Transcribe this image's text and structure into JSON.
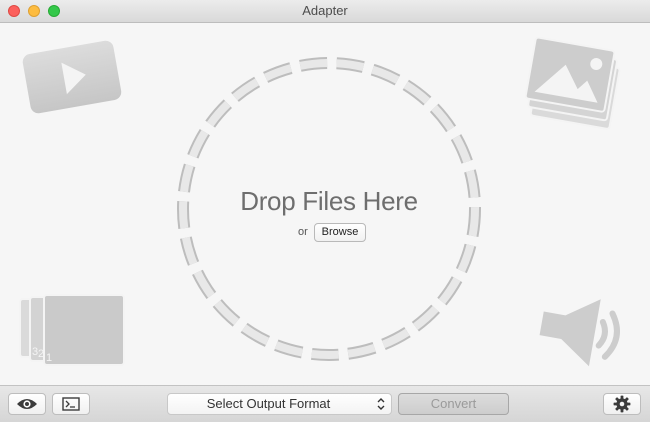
{
  "window": {
    "title": "Adapter"
  },
  "drop_zone": {
    "title": "Drop Files Here",
    "or_text": "or",
    "browse_label": "Browse"
  },
  "toolbar": {
    "format_placeholder": "Select Output Format",
    "convert_label": "Convert"
  },
  "colors": {
    "close": "#fc605c",
    "minimize": "#fdbc40",
    "zoom": "#34c84a",
    "icon_gray": "#cfcfcf",
    "ring_gray": "#d6d6d6"
  },
  "icons": [
    "video-icon",
    "image-icon",
    "image-sequence-icon",
    "audio-icon",
    "eye-icon",
    "terminal-icon",
    "gear-icon",
    "chevron-updown-icon"
  ]
}
